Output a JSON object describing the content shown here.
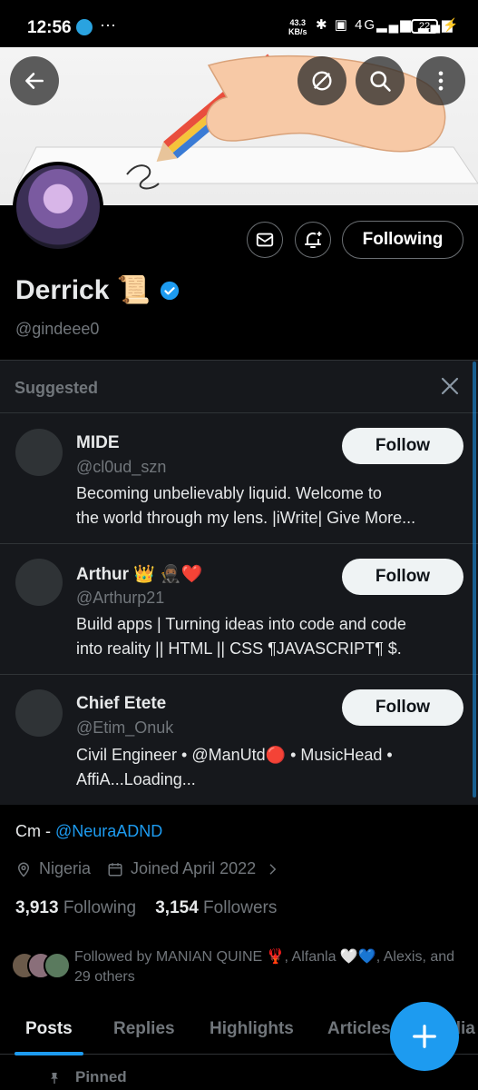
{
  "status_bar": {
    "time": "12:56",
    "more": "···",
    "speed_value": "43.3",
    "speed_unit": "KB/s",
    "network": "4G",
    "battery": "22"
  },
  "profile": {
    "name": "Derrick",
    "name_emoji": "📜",
    "handle": "@gindeee0",
    "following_button": "Following",
    "bio_prefix": "Cm - ",
    "bio_link": "@NeuraADND",
    "location": "Nigeria",
    "joined": "Joined April 2022",
    "following_count": "3,913",
    "following_label": "Following",
    "followers_count": "3,154",
    "followers_label": "Followers",
    "followed_by": "Followed by MANIAN QUINE 🦞, Alfanla 🤍💙, Alexis, and 29 others"
  },
  "suggested": {
    "title": "Suggested",
    "items": [
      {
        "name": "MIDE",
        "handle": "@cl0ud_szn",
        "bio_line1": "Becoming unbelievably liquid. Welcome to",
        "bio_line2": "the world through my lens. |iWrite|  Give More...",
        "follow_label": "Follow"
      },
      {
        "name": "Arthur 👑 🥷🏾❤️",
        "handle": "@Arthurp21",
        "bio_line1": "Build apps | Turning ideas into code and code",
        "bio_line2": "into reality || HTML || CSS ¶JAVASCRIPT¶ $.",
        "follow_label": "Follow"
      },
      {
        "name": "Chief Etete",
        "handle": "@Etim_Onuk",
        "bio_line1": "Civil Engineer • @ManUtd🔴 • MusicHead •",
        "bio_line2": "AffiA...Loading...",
        "follow_label": "Follow"
      }
    ]
  },
  "tabs": [
    "Posts",
    "Replies",
    "Highlights",
    "Articles",
    "Media"
  ],
  "pinned_label": "Pinned",
  "colors": {
    "accent": "#1d9bf0",
    "background": "#000000",
    "panel": "#16181c",
    "muted_text": "#71767b"
  },
  "icons": [
    "back-arrow-icon",
    "no-notifications-icon",
    "search-icon",
    "more-vertical-icon",
    "mail-icon",
    "bell-plus-icon",
    "verified-badge-icon",
    "close-icon",
    "location-pin-icon",
    "calendar-icon",
    "chevron-right-icon",
    "plus-icon",
    "pin-icon"
  ]
}
